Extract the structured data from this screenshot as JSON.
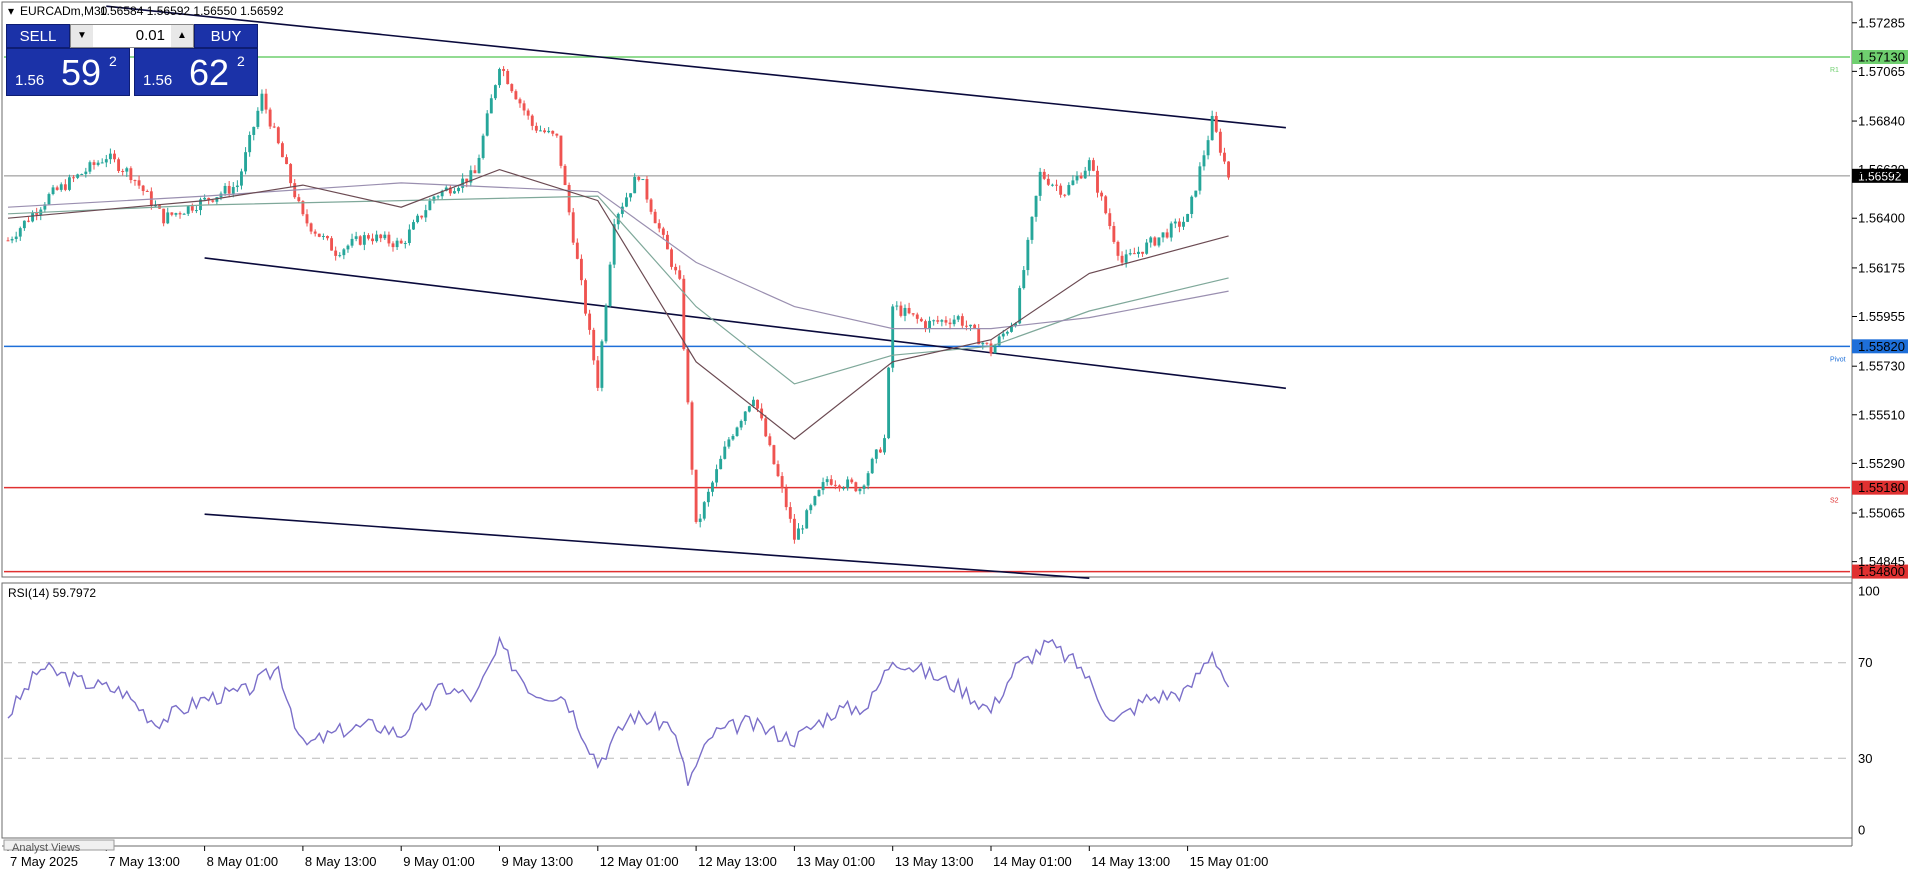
{
  "header": {
    "symbol": "EURCADm,M30",
    "ohlc": "1.56584 1.56592 1.56550 1.56592",
    "rsi": "RSI(14) 59.7972"
  },
  "trade_panel": {
    "sell_label": "SELL",
    "buy_label": "BUY",
    "lot": "0.01",
    "sell_prefix": "1.56",
    "sell_big": "59",
    "sell_sup": "2",
    "buy_prefix": "1.56",
    "buy_big": "62",
    "buy_sup": "2"
  },
  "colors": {
    "bull": "#26a69a",
    "bear": "#ef5350",
    "channel": "#0a0a3c",
    "r1": "#6fcf6f",
    "pivot": "#1e6fd9",
    "s2": "#e03131",
    "rsi": "#7b6fc9",
    "ma_fast": "#6b4a52",
    "ma_mid": "#9a8fb0",
    "ma_slow": "#7fa89a"
  },
  "chart_data": [
    {
      "type": "candlestick",
      "title": "EURCADm,M30",
      "x_tick_labels": [
        "7 May 2025",
        "7 May 13:00",
        "8 May 01:00",
        "8 May 13:00",
        "9 May 01:00",
        "9 May 13:00",
        "12 May 01:00",
        "12 May 13:00",
        "13 May 01:00",
        "13 May 13:00",
        "14 May 01:00",
        "14 May 13:00",
        "15 May 01:00"
      ],
      "y_tick_labels": [
        "1.57285",
        "1.57065",
        "1.56840",
        "1.56620",
        "1.56400",
        "1.56175",
        "1.55955",
        "1.55730",
        "1.55510",
        "1.55290",
        "1.55065",
        "1.54845"
      ],
      "ylim": [
        1.5478,
        1.5737
      ],
      "current_price": "1.56592",
      "levels": [
        {
          "label": "R1",
          "value": "1.57130",
          "color": "#6fcf6f"
        },
        {
          "label": "Pivot",
          "value": "1.55820",
          "color": "#1e6fd9"
        },
        {
          "label": "S2",
          "value": "1.55180",
          "color": "#e03131"
        },
        {
          "label": "",
          "value": "1.54800",
          "color": "#e03131"
        }
      ],
      "channel_lines": [
        {
          "x": [
            "7 May 13:00",
            "15 May 13:00"
          ],
          "y": [
            1.5736,
            1.5681
          ]
        },
        {
          "x": [
            "8 May 01:00",
            "15 May 13:00"
          ],
          "y": [
            1.5622,
            1.5563
          ]
        },
        {
          "x": [
            "8 May 01:00",
            "14 May 13:00"
          ],
          "y": [
            1.5506,
            1.5477
          ]
        }
      ],
      "close_path": [
        [
          "7 May 2025",
          1.563
        ],
        [
          "7 May 06:00",
          1.565
        ],
        [
          "7 May 13:00",
          1.5668
        ],
        [
          "7 May 16:00",
          1.566
        ],
        [
          "7 May 20:00",
          1.564
        ],
        [
          "8 May 01:00",
          1.5648
        ],
        [
          "8 May 05:00",
          1.5655
        ],
        [
          "8 May 08:00",
          1.5695
        ],
        [
          "8 May 13:00",
          1.564
        ],
        [
          "8 May 17:00",
          1.5625
        ],
        [
          "8 May 21:00",
          1.5632
        ],
        [
          "9 May 01:00",
          1.5628
        ],
        [
          "9 May 05:00",
          1.565
        ],
        [
          "9 May 10:00",
          1.566
        ],
        [
          "9 May 13:00",
          1.571
        ],
        [
          "9 May 17:00",
          1.5682
        ],
        [
          "9 May 20:00",
          1.5676
        ],
        [
          "12 May 01:00",
          1.5565
        ],
        [
          "12 May 03:00",
          1.564
        ],
        [
          "12 May 06:00",
          1.566
        ],
        [
          "12 May 09:00",
          1.563
        ],
        [
          "12 May 11:00",
          1.561
        ],
        [
          "12 May 13:00",
          1.55
        ],
        [
          "12 May 17:00",
          1.554
        ],
        [
          "12 May 20:00",
          1.556
        ],
        [
          "13 May 00:00",
          1.551
        ],
        [
          "13 May 01:00",
          1.5495
        ],
        [
          "13 May 05:00",
          1.5522
        ],
        [
          "13 May 09:00",
          1.5518
        ],
        [
          "13 May 12:00",
          1.554
        ],
        [
          "13 May 13:00",
          1.56
        ],
        [
          "13 May 17:00",
          1.5592
        ],
        [
          "13 May 21:00",
          1.5595
        ],
        [
          "14 May 01:00",
          1.558
        ],
        [
          "14 May 04:00",
          1.5595
        ],
        [
          "14 May 07:00",
          1.566
        ],
        [
          "14 May 10:00",
          1.5652
        ],
        [
          "14 May 13:00",
          1.5665
        ],
        [
          "14 May 17:00",
          1.562
        ],
        [
          "14 May 21:00",
          1.563
        ],
        [
          "15 May 01:00",
          1.564
        ],
        [
          "15 May 04:00",
          1.5684
        ],
        [
          "15 May 06:00",
          1.56592
        ]
      ],
      "ma_fast": [
        [
          "7 May 2025",
          1.564
        ],
        [
          "8 May 01:00",
          1.5648
        ],
        [
          "8 May 13:00",
          1.5655
        ],
        [
          "9 May 01:00",
          1.5645
        ],
        [
          "9 May 13:00",
          1.5662
        ],
        [
          "12 May 01:00",
          1.5648
        ],
        [
          "12 May 13:00",
          1.5575
        ],
        [
          "13 May 01:00",
          1.554
        ],
        [
          "13 May 13:00",
          1.5575
        ],
        [
          "14 May 01:00",
          1.5585
        ],
        [
          "14 May 13:00",
          1.5615
        ],
        [
          "15 May 06:00",
          1.5632
        ]
      ],
      "ma_mid": [
        [
          "7 May 2025",
          1.5645
        ],
        [
          "8 May 01:00",
          1.565
        ],
        [
          "9 May 01:00",
          1.5656
        ],
        [
          "12 May 01:00",
          1.5652
        ],
        [
          "12 May 13:00",
          1.562
        ],
        [
          "13 May 01:00",
          1.56
        ],
        [
          "13 May 13:00",
          1.559
        ],
        [
          "14 May 01:00",
          1.559
        ],
        [
          "14 May 13:00",
          1.5595
        ],
        [
          "15 May 06:00",
          1.5607
        ]
      ],
      "ma_slow": [
        [
          "7 May 2025",
          1.5642
        ],
        [
          "8 May 01:00",
          1.5646
        ],
        [
          "9 May 01:00",
          1.5648
        ],
        [
          "12 May 01:00",
          1.565
        ],
        [
          "12 May 13:00",
          1.56
        ],
        [
          "13 May 01:00",
          1.5565
        ],
        [
          "13 May 13:00",
          1.5578
        ],
        [
          "14 May 01:00",
          1.5582
        ],
        [
          "14 May 13:00",
          1.5598
        ],
        [
          "15 May 06:00",
          1.5613
        ]
      ]
    },
    {
      "type": "line",
      "title": "RSI(14) 59.7972",
      "y_tick_labels": [
        "100",
        "70",
        "30",
        "0"
      ],
      "ylim": [
        0,
        100
      ],
      "reference_lines": [
        70,
        30
      ],
      "series": [
        {
          "name": "RSI(14)",
          "values": [
            [
              "7 May 2025",
              48
            ],
            [
              "7 May 05:00",
              68
            ],
            [
              "7 May 10:00",
              62
            ],
            [
              "7 May 15:00",
              58
            ],
            [
              "7 May 19:00",
              45
            ],
            [
              "8 May 01:00",
              55
            ],
            [
              "8 May 06:00",
              58
            ],
            [
              "8 May 10:00",
              68
            ],
            [
              "8 May 13:00",
              35
            ],
            [
              "8 May 18:00",
              42
            ],
            [
              "8 May 22:00",
              44
            ],
            [
              "9 May 01:00",
              40
            ],
            [
              "9 May 06:00",
              60
            ],
            [
              "9 May 10:00",
              55
            ],
            [
              "9 May 13:00",
              77
            ],
            [
              "9 May 17:00",
              58
            ],
            [
              "9 May 21:00",
              56
            ],
            [
              "12 May 01:00",
              28
            ],
            [
              "12 May 05:00",
              48
            ],
            [
              "12 May 10:00",
              44
            ],
            [
              "12 May 12:00",
              20
            ],
            [
              "12 May 15:00",
              40
            ],
            [
              "12 May 19:00",
              45
            ],
            [
              "13 May 01:00",
              38
            ],
            [
              "13 May 06:00",
              50
            ],
            [
              "13 May 10:00",
              52
            ],
            [
              "13 May 13:00",
              72
            ],
            [
              "13 May 17:00",
              66
            ],
            [
              "13 May 21:00",
              60
            ],
            [
              "14 May 01:00",
              50
            ],
            [
              "14 May 04:00",
              68
            ],
            [
              "14 May 08:00",
              78
            ],
            [
              "14 May 12:00",
              68
            ],
            [
              "14 May 16:00",
              45
            ],
            [
              "14 May 20:00",
              55
            ],
            [
              "15 May 01:00",
              58
            ],
            [
              "15 May 04:00",
              75
            ],
            [
              "15 May 06:00",
              59.8
            ]
          ]
        }
      ]
    }
  ],
  "bottom_tab": "Analyst Views"
}
